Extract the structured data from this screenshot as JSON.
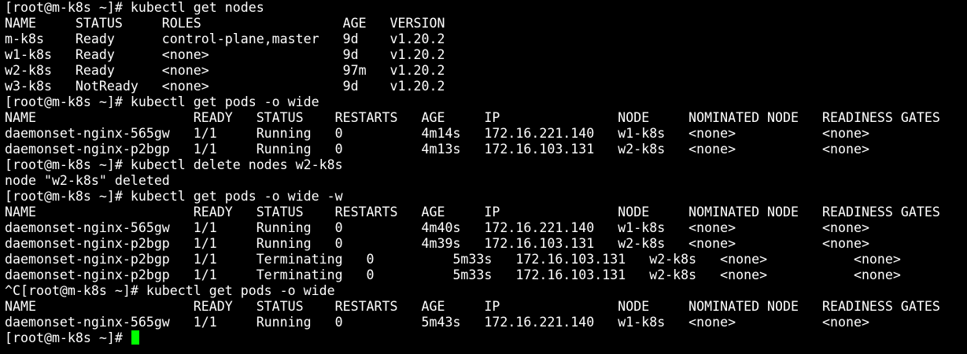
{
  "terminal": {
    "lines": [
      "[root@m-k8s ~]# kubectl get nodes",
      "NAME     STATUS     ROLES                  AGE   VERSION",
      "m-k8s    Ready      control-plane,master   9d    v1.20.2",
      "w1-k8s   Ready      <none>                 9d    v1.20.2",
      "w2-k8s   Ready      <none>                 97m   v1.20.2",
      "w3-k8s   NotReady   <none>                 9d    v1.20.2",
      "[root@m-k8s ~]# kubectl get pods -o wide",
      "NAME                    READY   STATUS    RESTARTS   AGE     IP               NODE     NOMINATED NODE   READINESS GATES",
      "daemonset-nginx-565gw   1/1     Running   0          4m14s   172.16.221.140   w1-k8s   <none>           <none>",
      "daemonset-nginx-p2bgp   1/1     Running   0          4m13s   172.16.103.131   w2-k8s   <none>           <none>",
      "[root@m-k8s ~]# kubectl delete nodes w2-k8s",
      "node \"w2-k8s\" deleted",
      "[root@m-k8s ~]# kubectl get pods -o wide -w",
      "NAME                    READY   STATUS    RESTARTS   AGE     IP               NODE     NOMINATED NODE   READINESS GATES",
      "daemonset-nginx-565gw   1/1     Running   0          4m40s   172.16.221.140   w1-k8s   <none>           <none>",
      "daemonset-nginx-p2bgp   1/1     Running   0          4m39s   172.16.103.131   w2-k8s   <none>           <none>",
      "daemonset-nginx-p2bgp   1/1     Terminating   0          5m33s   172.16.103.131   w2-k8s   <none>           <none>",
      "daemonset-nginx-p2bgp   1/1     Terminating   0          5m33s   172.16.103.131   w2-k8s   <none>           <none>",
      "^C[root@m-k8s ~]# kubectl get pods -o wide",
      "NAME                    READY   STATUS    RESTARTS   AGE     IP               NODE     NOMINATED NODE   READINESS GATES",
      "daemonset-nginx-565gw   1/1     Running   0          5m43s   172.16.221.140   w1-k8s   <none>           <none>"
    ],
    "prompt": "[root@m-k8s ~]# ",
    "colors": {
      "background": "#000000",
      "text": "#ffffff",
      "cursor": "#00ff00"
    }
  }
}
